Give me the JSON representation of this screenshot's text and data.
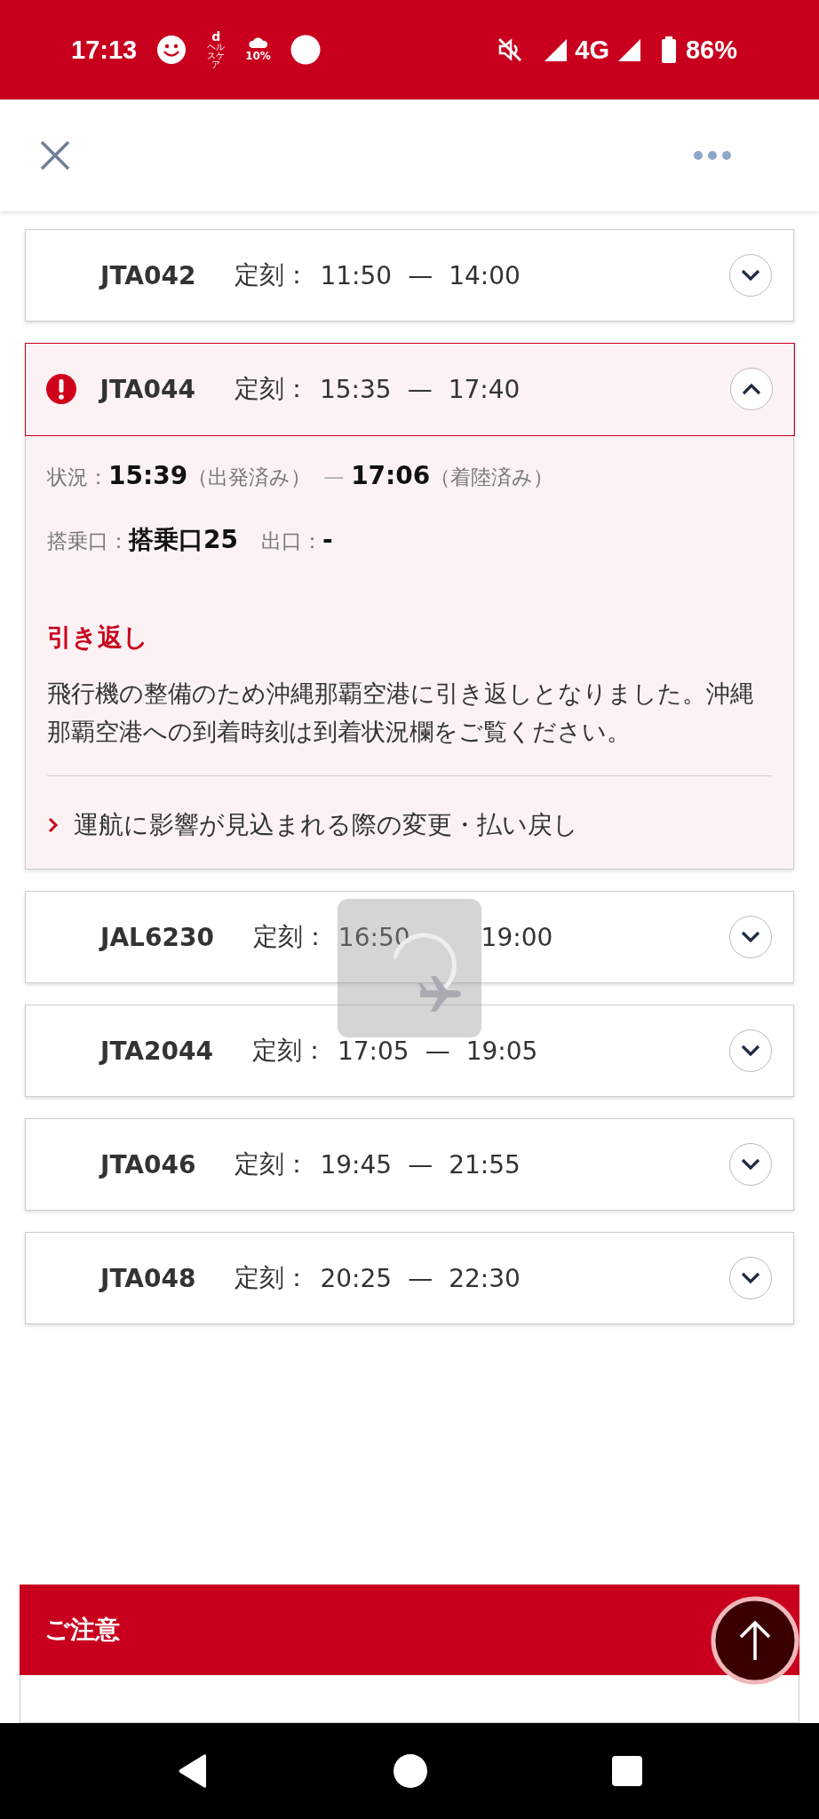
{
  "status_bar": {
    "time": "17:13",
    "app_icon_text": "d",
    "app_icon_caption": "ヘルスケア",
    "weather": "10%",
    "network": "4G",
    "battery": "86%"
  },
  "flights": [
    {
      "number": "JTA042",
      "label": "定刻：",
      "departure": "11:50",
      "separator": "—",
      "arrival": "14:00",
      "expanded": false,
      "alert": false
    },
    {
      "number": "JTA044",
      "label": "定刻：",
      "departure": "15:35",
      "separator": "—",
      "arrival": "17:40",
      "expanded": true,
      "alert": true,
      "details": {
        "status_label": "状況：",
        "departure_time": "15:39",
        "departure_note": "（出発済み）",
        "dash": "—",
        "arrival_time": "17:06",
        "arrival_note": "（着陸済み）",
        "gate_label": "搭乗口：",
        "gate": "搭乗口25",
        "exit_label": "出口：",
        "exit": "-",
        "notice_title": "引き返し",
        "notice_text": "飛行機の整備のため沖縄那覇空港に引き返しとなりました。沖縄那覇空港への到着時刻は到着状況欄をご覧ください。",
        "link": "運航に影響が見込まれる際の変更・払い戻し"
      }
    },
    {
      "number": "JAL6230",
      "label": "定刻：",
      "departure": "16:50",
      "arrival": "19:00",
      "expanded": false,
      "alert": false
    },
    {
      "number": "JTA2044",
      "label": "定刻：",
      "departure": "17:05",
      "separator": "—",
      "arrival": "19:05",
      "expanded": false,
      "alert": false
    },
    {
      "number": "JTA046",
      "label": "定刻：",
      "departure": "19:45",
      "separator": "—",
      "arrival": "21:55",
      "expanded": false,
      "alert": false
    },
    {
      "number": "JTA048",
      "label": "定刻：",
      "departure": "20:25",
      "separator": "—",
      "arrival": "22:30",
      "expanded": false,
      "alert": false
    }
  ],
  "loading": true,
  "caution": {
    "title": "ご注意"
  }
}
